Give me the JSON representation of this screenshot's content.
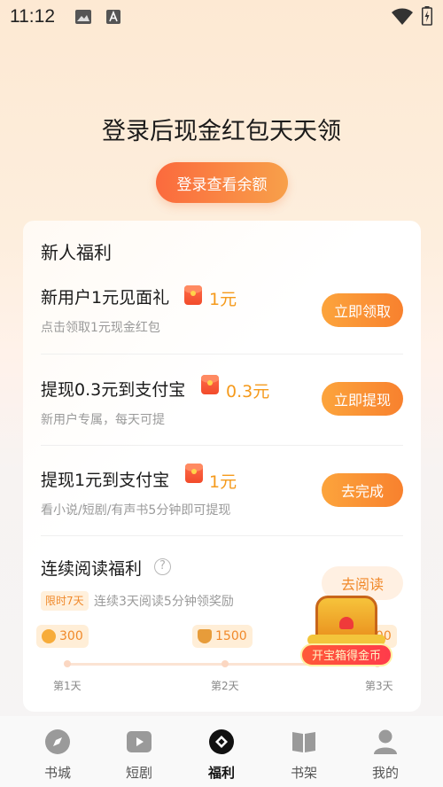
{
  "status_bar": {
    "time": "11:12"
  },
  "hero": {
    "title": "登录后现金红包天天领",
    "login_button": "登录查看余额"
  },
  "card": {
    "title": "新人福利",
    "tasks": [
      {
        "name": "新用户1元见面礼",
        "reward": "1元",
        "desc": "点击领取1元现金红包",
        "button": "立即领取"
      },
      {
        "name": "提现0.3元到支付宝",
        "reward": "0.3元",
        "desc": "新用户专属，每天可提",
        "button": "立即提现"
      },
      {
        "name": "提现1元到支付宝",
        "reward": "1元",
        "desc": "看小说/短剧/有声书5分钟即可提现",
        "button": "去完成"
      }
    ],
    "reading": {
      "title": "连续阅读福利",
      "help": "?",
      "badge": "限时7天",
      "desc": "连续3天阅读5分钟领奖励",
      "button": "去阅读",
      "days": [
        {
          "reward": "300",
          "label": "第1天"
        },
        {
          "reward": "1500",
          "label": "第2天"
        },
        {
          "reward": "300",
          "label": "第3天"
        }
      ]
    }
  },
  "treasure": {
    "label": "开宝箱得金币"
  },
  "nav": {
    "items": [
      {
        "label": "书城",
        "icon": "compass-icon"
      },
      {
        "label": "短剧",
        "icon": "play-icon"
      },
      {
        "label": "福利",
        "icon": "welfare-icon"
      },
      {
        "label": "书架",
        "icon": "book-icon"
      },
      {
        "label": "我的",
        "icon": "user-icon"
      }
    ],
    "active_index": 2
  },
  "colors": {
    "accent_orange": "#f8812e",
    "reward_text": "#f59a1c",
    "login_gradient_start": "#fb6a3d",
    "login_gradient_end": "#f8a04a"
  }
}
